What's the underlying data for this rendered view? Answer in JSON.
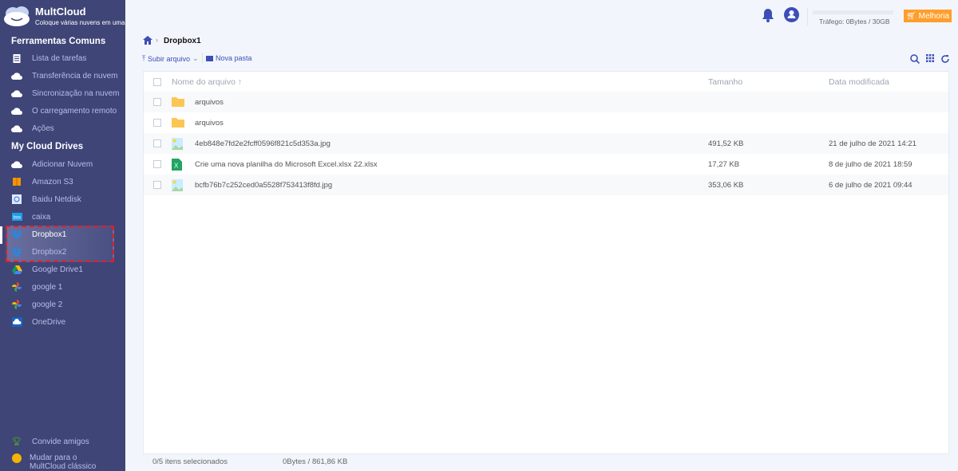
{
  "app": {
    "brand": "MultCloud",
    "tagline": "Coloque várias nuvens em uma"
  },
  "sidebar": {
    "section1": "Ferramentas Comuns",
    "tools": [
      {
        "label": "Lista de tarefas",
        "icon": "clipboard-icon"
      },
      {
        "label": "Transferência de nuvem",
        "icon": "cloud-transfer-icon"
      },
      {
        "label": "Sincronização na nuvem",
        "icon": "cloud-sync-icon"
      },
      {
        "label": "O carregamento remoto",
        "icon": "cloud-upload-icon"
      },
      {
        "label": "Ações",
        "icon": "cloud-share-icon"
      }
    ],
    "section2": "My Cloud Drives",
    "drives": [
      {
        "label": "Adicionar Nuvem",
        "icon": "add-cloud-icon"
      },
      {
        "label": "Amazon S3",
        "icon": "amazon-s3-icon"
      },
      {
        "label": "Baidu Netdisk",
        "icon": "baidu-icon"
      },
      {
        "label": "caixa",
        "icon": "box-icon"
      },
      {
        "label": "Dropbox1",
        "icon": "dropbox-icon",
        "active": true
      },
      {
        "label": "Dropbox2",
        "icon": "dropbox-icon"
      },
      {
        "label": "Google Drive1",
        "icon": "google-drive-icon"
      },
      {
        "label": "google 1",
        "icon": "google-photos-icon"
      },
      {
        "label": "google 2",
        "icon": "google-photos-icon"
      },
      {
        "label": "OneDrive",
        "icon": "onedrive-icon"
      }
    ],
    "invite": "Convide amigos",
    "classic": "Mudar para o MultCloud clássico"
  },
  "topbar": {
    "traffic": "Tráfego: 0Bytes / 30GB",
    "traffic_used_percent": 0,
    "upgrade": "Melhoria"
  },
  "breadcrumb": {
    "current": "Dropbox1"
  },
  "toolbar": {
    "upload": "Subir arquivo",
    "new_folder": "Nova pasta"
  },
  "table": {
    "columns": [
      "Nome do arquivo",
      "Tamanho",
      "Data modificada"
    ],
    "rows": [
      {
        "name": "arquivos",
        "size": "",
        "date": "",
        "type": "folder"
      },
      {
        "name": "arquivos",
        "size": "",
        "date": "",
        "type": "folder"
      },
      {
        "name": "4eb848e7fd2e2fcff0596f821c5d353a.jpg",
        "size": "491,52 KB",
        "date": "21 de julho de 2021 14:21",
        "type": "image"
      },
      {
        "name": "Crie uma nova planilha do Microsoft Excel.xlsx 22.xlsx",
        "size": "17,27 KB",
        "date": "8 de julho de 2021 18:59",
        "type": "excel"
      },
      {
        "name": "bcfb76b7c252ced0a5528f753413f8fd.jpg",
        "size": "353,06 KB",
        "date": "6 de julho de 2021 09:44",
        "type": "image"
      }
    ]
  },
  "footer": {
    "selected": "0/5 itens selecionados",
    "size": "0Bytes / 861,86 KB"
  },
  "colors": {
    "sidebar": "#3f4577",
    "accent": "#3d4eb8",
    "upgrade": "#ff9e2c",
    "highlight": "#e0202a"
  }
}
